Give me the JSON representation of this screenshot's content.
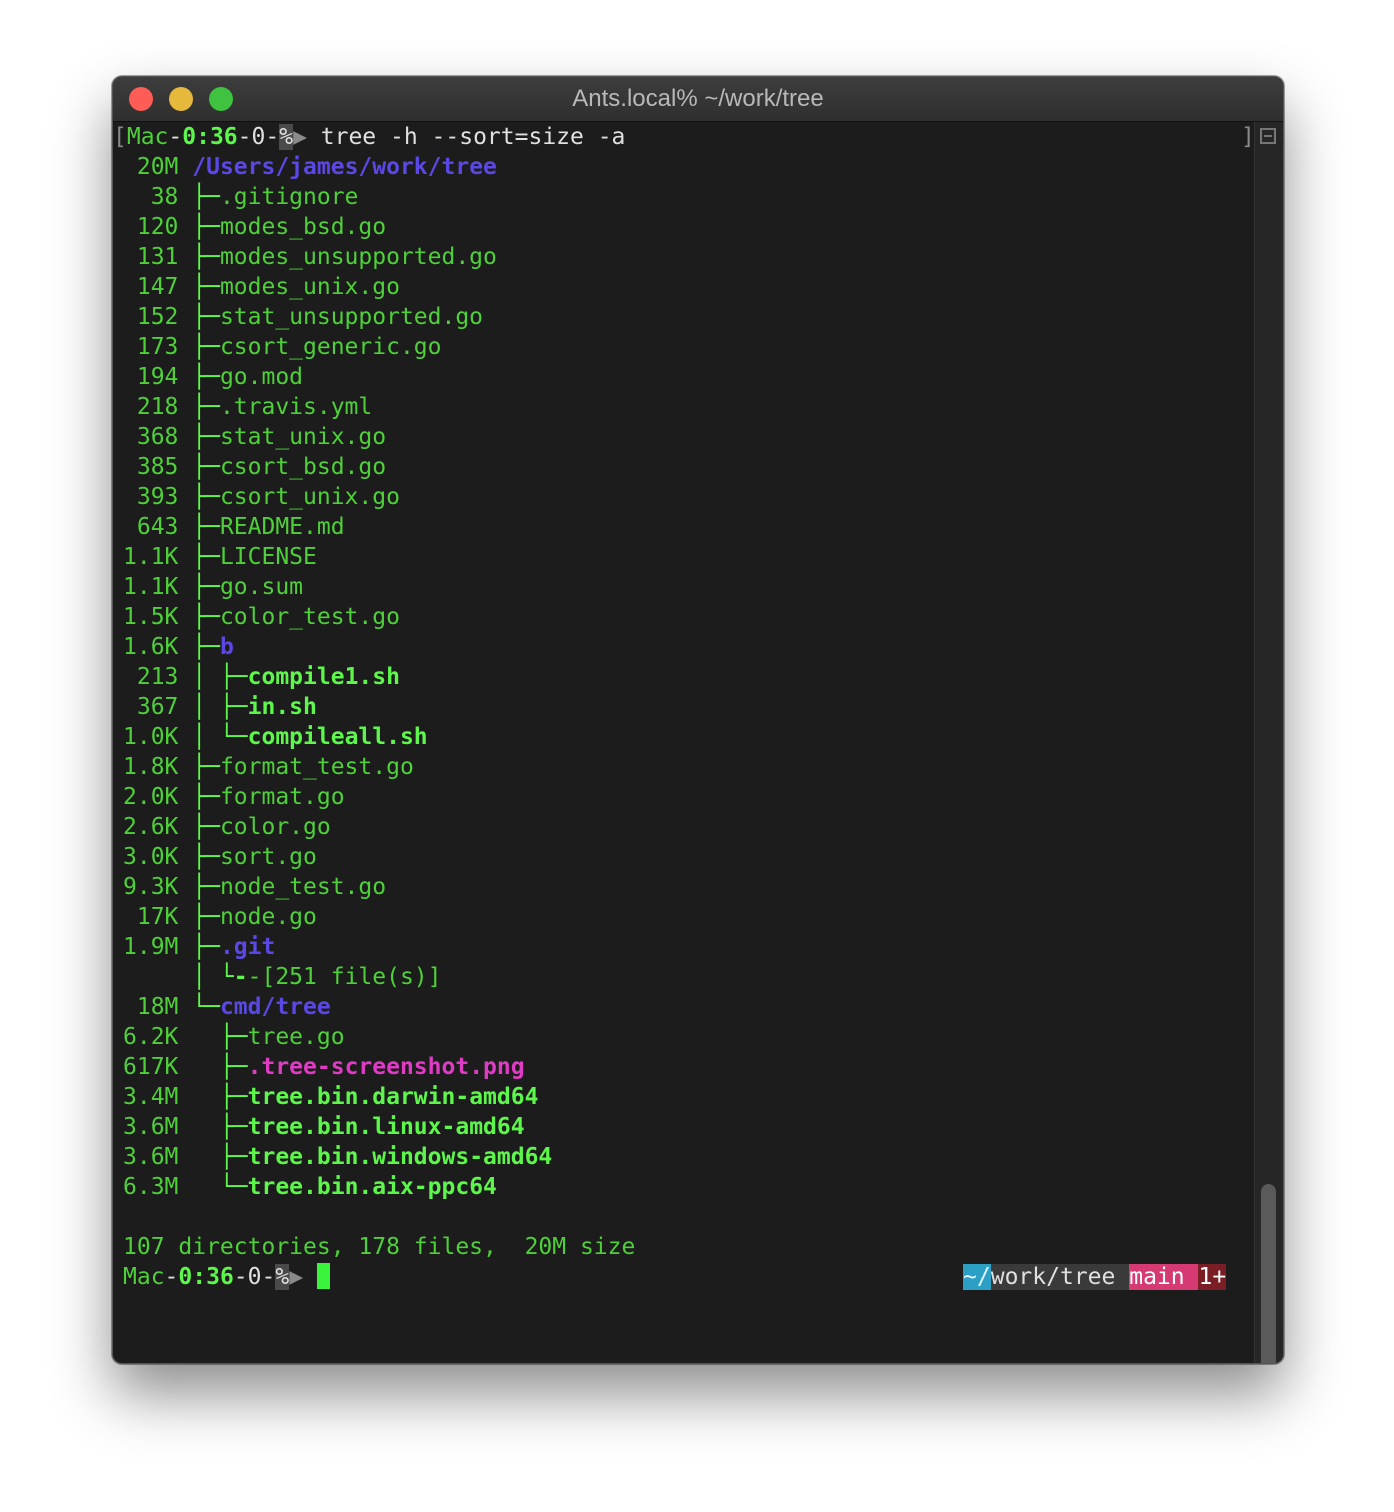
{
  "window": {
    "title": "Ants.local% ~/work/tree"
  },
  "colors": {
    "green": "#4fd03a",
    "bright_green": "#5cf74a",
    "blue": "#5a48e6",
    "magenta": "#df3bc5",
    "white": "#e0e0e0",
    "gray": "#8a8a8a",
    "cursor": "#39f43a",
    "status_cyan": "#2b9fc4",
    "status_gray": "#3a3a3a",
    "status_pink": "#d63a73",
    "status_darkred": "#7a1d24",
    "traffic_close": "#fd5d55",
    "traffic_min": "#e6b83b",
    "traffic_max": "#3fc23f"
  },
  "prompt": {
    "left_bracket": "[",
    "host": "Mac",
    "sep1": "-",
    "time": "0:36",
    "sep2": "-0-",
    "symbol": "%",
    "arrow": "▶",
    "command": " tree -h --sort=size -a",
    "right_bracket": "]"
  },
  "tree": {
    "root": {
      "size": " 20M",
      "path": "/Users/james/work/tree"
    },
    "entries": [
      {
        "size": "  38",
        "branch": " ├─",
        "name": ".gitignore",
        "kind": "file"
      },
      {
        "size": " 120",
        "branch": " ├─",
        "name": "modes_bsd.go",
        "kind": "file"
      },
      {
        "size": " 131",
        "branch": " ├─",
        "name": "modes_unsupported.go",
        "kind": "file"
      },
      {
        "size": " 147",
        "branch": " ├─",
        "name": "modes_unix.go",
        "kind": "file"
      },
      {
        "size": " 152",
        "branch": " ├─",
        "name": "stat_unsupported.go",
        "kind": "file"
      },
      {
        "size": " 173",
        "branch": " ├─",
        "name": "csort_generic.go",
        "kind": "file"
      },
      {
        "size": " 194",
        "branch": " ├─",
        "name": "go.mod",
        "kind": "file"
      },
      {
        "size": " 218",
        "branch": " ├─",
        "name": ".travis.yml",
        "kind": "file"
      },
      {
        "size": " 368",
        "branch": " ├─",
        "name": "stat_unix.go",
        "kind": "file"
      },
      {
        "size": " 385",
        "branch": " ├─",
        "name": "csort_bsd.go",
        "kind": "file"
      },
      {
        "size": " 393",
        "branch": " ├─",
        "name": "csort_unix.go",
        "kind": "file"
      },
      {
        "size": " 643",
        "branch": " ├─",
        "name": "README.md",
        "kind": "file"
      },
      {
        "size": "1.1K",
        "branch": " ├─",
        "name": "LICENSE",
        "kind": "file"
      },
      {
        "size": "1.1K",
        "branch": " ├─",
        "name": "go.sum",
        "kind": "file"
      },
      {
        "size": "1.5K",
        "branch": " ├─",
        "name": "color_test.go",
        "kind": "file"
      },
      {
        "size": "1.6K",
        "branch": " ├─",
        "name": "b",
        "kind": "dir"
      },
      {
        "size": " 213",
        "branch": " │ ├─",
        "name": "compile1.sh",
        "kind": "exec"
      },
      {
        "size": " 367",
        "branch": " │ ├─",
        "name": "in.sh",
        "kind": "exec"
      },
      {
        "size": "1.0K",
        "branch": " │ └─",
        "name": "compileall.sh",
        "kind": "exec"
      },
      {
        "size": "1.8K",
        "branch": " ├─",
        "name": "format_test.go",
        "kind": "file"
      },
      {
        "size": "2.0K",
        "branch": " ├─",
        "name": "format.go",
        "kind": "file"
      },
      {
        "size": "2.6K",
        "branch": " ├─",
        "name": "color.go",
        "kind": "file"
      },
      {
        "size": "3.0K",
        "branch": " ├─",
        "name": "sort.go",
        "kind": "file"
      },
      {
        "size": "9.3K",
        "branch": " ├─",
        "name": "node_test.go",
        "kind": "file"
      },
      {
        "size": " 17K",
        "branch": " ├─",
        "name": "node.go",
        "kind": "file"
      },
      {
        "size": "1.9M",
        "branch": " ├─",
        "name": ".git",
        "kind": "dir"
      },
      {
        "size": "    ",
        "branch": " │ └-",
        "name": "-[251 file(s)]",
        "kind": "summary"
      },
      {
        "size": " 18M",
        "branch": " └─",
        "name": "cmd/tree",
        "kind": "dirpath"
      },
      {
        "size": "6.2K",
        "branch": "   ├─",
        "name": "tree.go",
        "kind": "file"
      },
      {
        "size": "617K",
        "branch": "   ├─",
        "name": ".tree-screenshot.png",
        "kind": "image"
      },
      {
        "size": "3.4M",
        "branch": "   ├─",
        "name": "tree.bin.darwin-amd64",
        "kind": "exec"
      },
      {
        "size": "3.6M",
        "branch": "   ├─",
        "name": "tree.bin.linux-amd64",
        "kind": "exec"
      },
      {
        "size": "3.6M",
        "branch": "   ├─",
        "name": "tree.bin.windows-amd64",
        "kind": "exec"
      },
      {
        "size": "6.3M",
        "branch": "   └─",
        "name": "tree.bin.aix-ppc64",
        "kind": "exec"
      }
    ],
    "summary": "107 directories, 178 files,  20M size"
  },
  "prompt2": {
    "host": "Mac",
    "sep1": "-",
    "time": "0:36",
    "sep2": "-0-",
    "symbol": "%",
    "arrow": "▶"
  },
  "status": {
    "tilde": "~",
    "slash1": "/",
    "work": "work",
    "slash2": "/",
    "tree": "tree",
    "branch": "main",
    "changes": "1+"
  }
}
